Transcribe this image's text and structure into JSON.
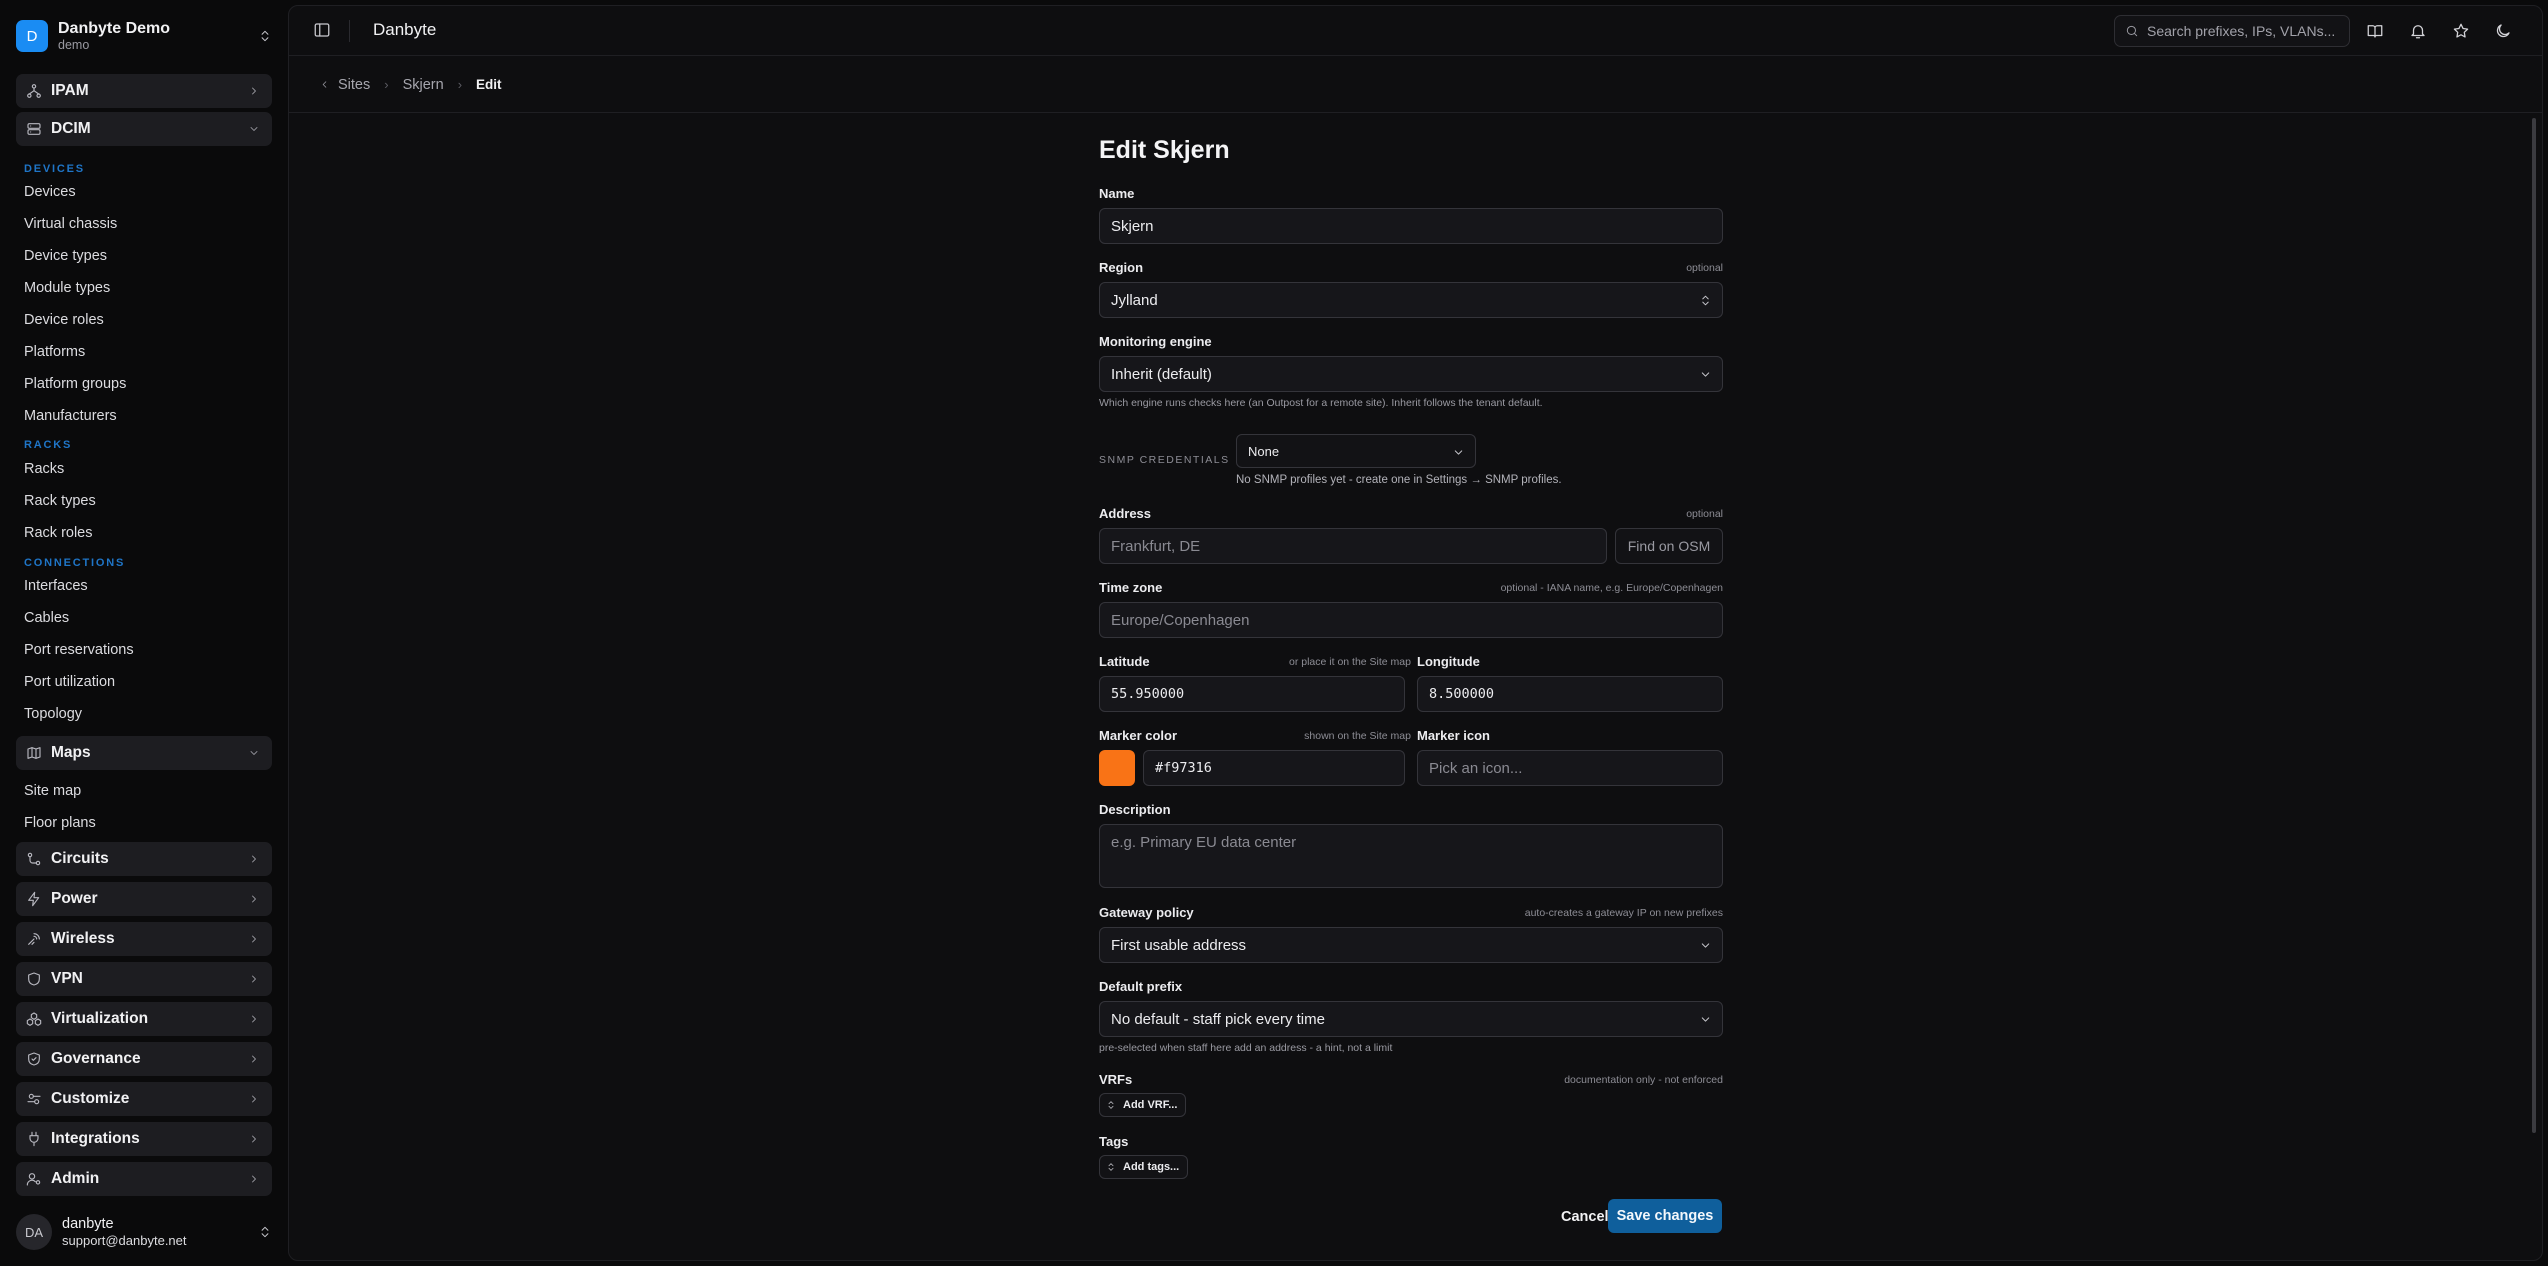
{
  "workspace": {
    "initial": "D",
    "name": "Danbyte Demo",
    "subtitle": "demo"
  },
  "sidebar": {
    "groups": {
      "ipam": "IPAM",
      "dcim": "DCIM",
      "maps": "Maps",
      "circuits": "Circuits",
      "power": "Power",
      "wireless": "Wireless",
      "vpn": "VPN",
      "virtualization": "Virtualization",
      "governance": "Governance",
      "customize": "Customize",
      "integrations": "Integrations",
      "admin": "Admin"
    },
    "sections": {
      "devices": "DEVICES",
      "racks": "RACKS",
      "connections": "CONNECTIONS"
    },
    "items": {
      "devices": "Devices",
      "virtual_chassis": "Virtual chassis",
      "device_types": "Device types",
      "module_types": "Module types",
      "device_roles": "Device roles",
      "platforms": "Platforms",
      "platform_groups": "Platform groups",
      "manufacturers": "Manufacturers",
      "racks": "Racks",
      "rack_types": "Rack types",
      "rack_roles": "Rack roles",
      "interfaces": "Interfaces",
      "cables": "Cables",
      "port_reservations": "Port reservations",
      "port_utilization": "Port utilization",
      "topology": "Topology",
      "site_map": "Site map",
      "floor_plans": "Floor plans"
    }
  },
  "user": {
    "initials": "DA",
    "name": "danbyte",
    "email": "support@danbyte.net"
  },
  "topbar": {
    "title": "Danbyte",
    "search_placeholder": "Search prefixes, IPs, VLANs..."
  },
  "breadcrumb": {
    "sites": "Sites",
    "site": "Skjern",
    "current": "Edit"
  },
  "form": {
    "title": "Edit Skjern",
    "name": {
      "label": "Name",
      "value": "Skjern"
    },
    "region": {
      "label": "Region",
      "note": "optional",
      "value": "Jylland"
    },
    "monitoring": {
      "label": "Monitoring engine",
      "value": "Inherit (default)",
      "hint": "Which engine runs checks here (an Outpost for a remote site). Inherit follows the tenant default."
    },
    "snmp": {
      "label": "SNMP CREDENTIALS",
      "value": "None",
      "hint": "No SNMP profiles yet - create one in Settings → SNMP profiles."
    },
    "address": {
      "label": "Address",
      "note": "optional",
      "placeholder": "Frankfurt, DE",
      "find_button": "Find on OSM"
    },
    "timezone": {
      "label": "Time zone",
      "note": "optional - IANA name, e.g. Europe/Copenhagen",
      "placeholder": "Europe/Copenhagen"
    },
    "latitude": {
      "label": "Latitude",
      "note": "or place it on the Site map",
      "value": "55.950000"
    },
    "longitude": {
      "label": "Longitude",
      "value": "8.500000"
    },
    "marker_color": {
      "label": "Marker color",
      "note": "shown on the Site map",
      "value": "#f97316"
    },
    "marker_icon": {
      "label": "Marker icon",
      "placeholder": "Pick an icon..."
    },
    "description": {
      "label": "Description",
      "placeholder": "e.g. Primary EU data center"
    },
    "gateway": {
      "label": "Gateway policy",
      "note": "auto-creates a gateway IP on new prefixes",
      "value": "First usable address"
    },
    "default_prefix": {
      "label": "Default prefix",
      "value": "No default - staff pick every time",
      "hint": "pre-selected when staff here add an address - a hint, not a limit"
    },
    "vrfs": {
      "label": "VRFs",
      "note": "documentation only - not enforced",
      "button": "Add VRF..."
    },
    "tags": {
      "label": "Tags",
      "button": "Add tags..."
    },
    "cancel": "Cancel",
    "save": "Save changes"
  },
  "colors": {
    "accent": "#0f5f9c",
    "section": "#1f75c7",
    "marker": "#f97316",
    "workspace": "#1a8cf3"
  }
}
